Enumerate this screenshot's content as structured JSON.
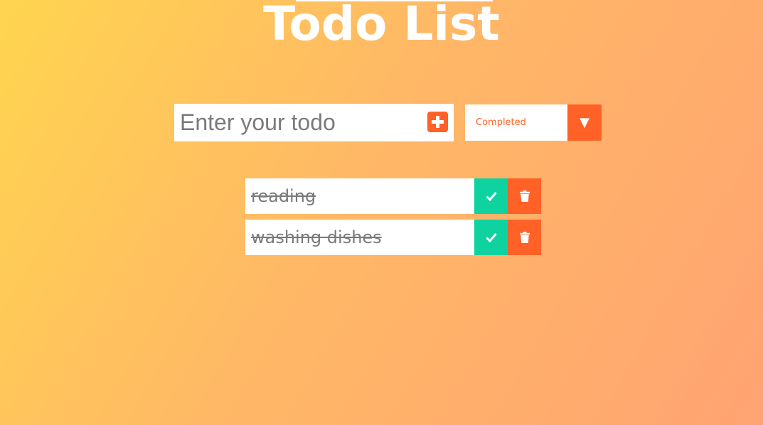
{
  "app": {
    "title": "Todo List"
  },
  "form": {
    "input_placeholder": "Enter your todo",
    "input_value": "",
    "add_icon": "plus-square-icon"
  },
  "filter": {
    "selected": "Completed",
    "arrow_glyph": "▼"
  },
  "todos": [
    {
      "text": "reading",
      "completed": true
    },
    {
      "text": "washing dishes",
      "completed": true
    }
  ],
  "icons": {
    "complete": "check-icon",
    "delete": "trash-icon"
  },
  "colors": {
    "accent": "#ff6126",
    "complete": "#0ed3a1",
    "background_start": "#ffd54f",
    "background_end": "#ffa372"
  }
}
